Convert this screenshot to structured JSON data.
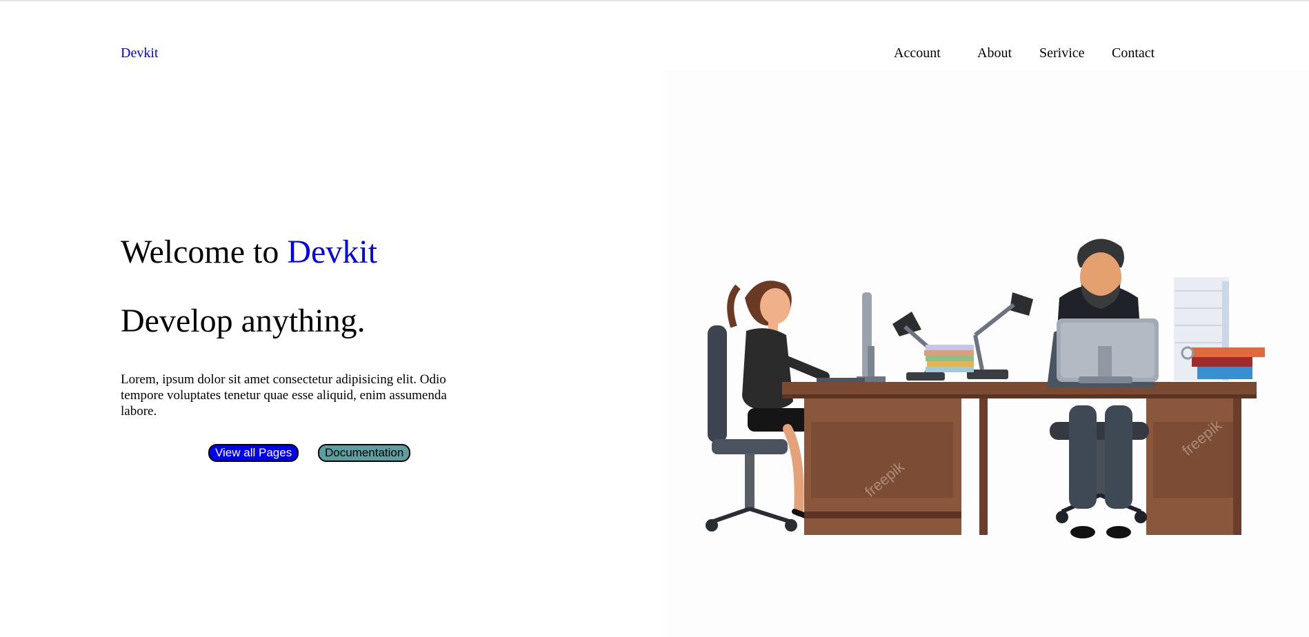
{
  "header": {
    "brand": "Devkit",
    "nav": {
      "account": "Account",
      "about": "About",
      "service": "Serivice",
      "contact": "Contact"
    }
  },
  "hero": {
    "title_prefix": "Welcome to ",
    "title_accent": "Devkit",
    "subtitle": "Develop anything.",
    "description": "Lorem, ipsum dolor sit amet consectetur adipisicing elit. Odio tempore voluptates tenetur quae esse aliquid, enim assumenda labore.",
    "primary_button": "View all Pages",
    "secondary_button": "Documentation"
  },
  "illustration": {
    "watermark": "freepik"
  },
  "colors": {
    "accent": "#0000ee",
    "secondary_button": "#5f9ea0",
    "desk": "#7a4a33"
  }
}
